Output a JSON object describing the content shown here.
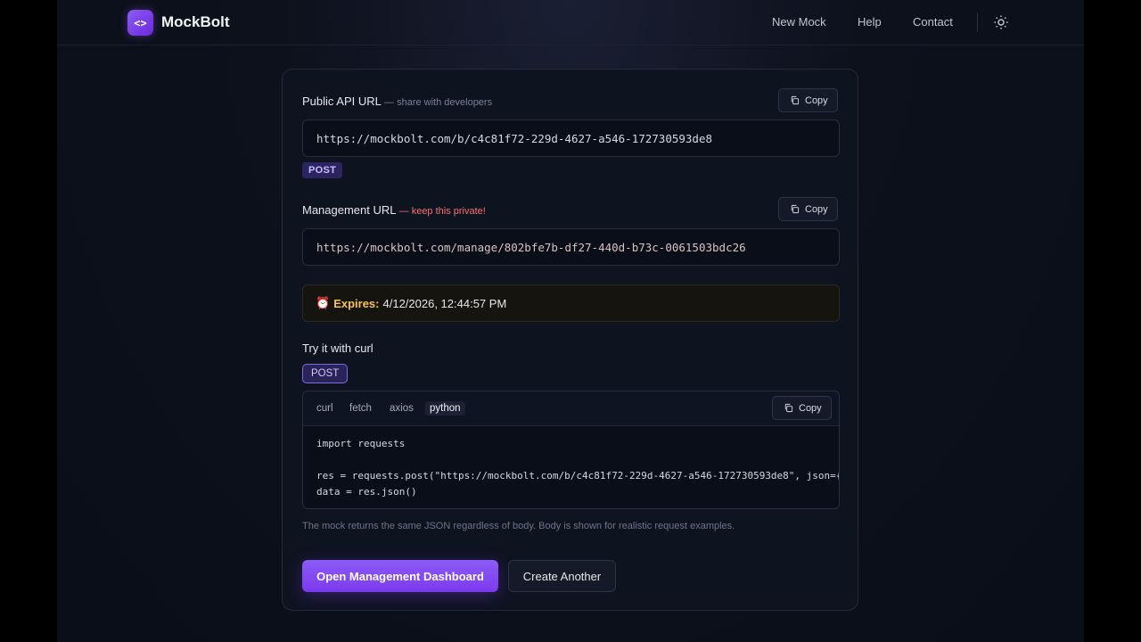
{
  "header": {
    "logo_glyph": "<>",
    "brand": "MockBolt",
    "nav": [
      "New Mock",
      "Help",
      "Contact"
    ],
    "theme_icon": "sun-icon"
  },
  "public_url": {
    "label": "Public API URL",
    "hint": "— share with developers",
    "copy_label": "Copy",
    "value": "https://mockbolt.com/b/c4c81f72-229d-4627-a546-172730593de8",
    "method": "POST"
  },
  "management_url": {
    "label": "Management URL",
    "warning": "— keep this private!",
    "copy_label": "Copy",
    "value": "https://mockbolt.com/manage/802bfe7b-df27-440d-b73c-0061503bdc26"
  },
  "expires": {
    "icon": "⏰",
    "label": "Expires:",
    "value": "4/12/2026, 12:44:57 PM"
  },
  "try_it": {
    "title": "Try it with curl",
    "method": "POST",
    "tabs": [
      "curl",
      "fetch",
      "axios",
      "python"
    ],
    "active_tab": "python",
    "copy_label": "Copy",
    "code": "import requests\n\nres = requests.post(\"https://mockbolt.com/b/c4c81f72-229d-4627-a546-172730593de8\", json={\"message\": \"hello\"})\ndata = res.json()"
  },
  "footnote": "The mock returns the same JSON regardless of body. Body is shown for realistic request examples.",
  "actions": {
    "primary": "Open Management Dashboard",
    "secondary": "Create Another"
  },
  "colors": {
    "accent": "#7c3aed",
    "warning": "#f87171",
    "expires_label": "#f5c451"
  }
}
